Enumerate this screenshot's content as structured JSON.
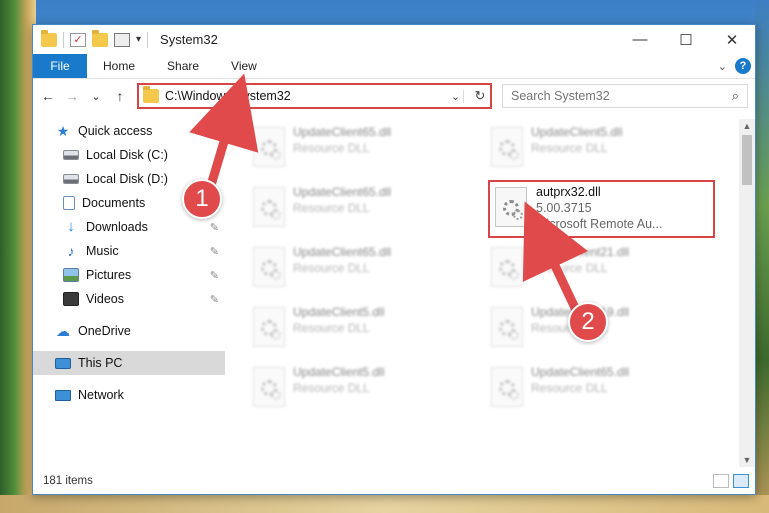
{
  "window": {
    "title": "System32",
    "controls": {
      "minimize": "—",
      "maximize": "☐",
      "close": "✕"
    }
  },
  "ribbon": {
    "file_tab": "File",
    "tabs": [
      "Home",
      "Share",
      "View"
    ],
    "expand_icon": "chevron-down-icon",
    "help": "?"
  },
  "nav": {
    "back": "←",
    "forward": "→",
    "recent": "⌄",
    "up": "↑"
  },
  "address": {
    "path": "C:\\Windows\\System32",
    "dropdown": "⌄",
    "refresh": "↻"
  },
  "search": {
    "placeholder": "Search System32",
    "icon": "⌕"
  },
  "sidebar": {
    "items": [
      {
        "label": "Quick access",
        "icon": "star-icon",
        "pinned": false
      },
      {
        "label": "Local Disk (C:)",
        "icon": "disk-icon",
        "pinned": false
      },
      {
        "label": "Local Disk (D:)",
        "icon": "disk-icon",
        "pinned": false
      },
      {
        "label": "Documents",
        "icon": "document-icon",
        "pinned": false
      },
      {
        "label": "Downloads",
        "icon": "download-icon",
        "pinned": true
      },
      {
        "label": "Music",
        "icon": "music-icon",
        "pinned": true
      },
      {
        "label": "Pictures",
        "icon": "pictures-icon",
        "pinned": true
      },
      {
        "label": "Videos",
        "icon": "video-icon",
        "pinned": true
      },
      {
        "label": "OneDrive",
        "icon": "cloud-icon"
      },
      {
        "label": "This PC",
        "icon": "computer-icon",
        "selected": true
      },
      {
        "label": "Network",
        "icon": "network-icon"
      }
    ],
    "pin_glyph": "📌"
  },
  "files": [
    {
      "name": "UpdateClient65.dll",
      "type": "Resource DLL"
    },
    {
      "name": "UpdateClient5.dll",
      "type": "Resource DLL"
    },
    {
      "name": "UpdateClient65.dll",
      "type": "Resource DLL"
    },
    {
      "name": "UpdateClient65.dll",
      "type": "Resource DLL"
    },
    {
      "name": "UpdateClient21.dll",
      "type": "Resource DLL"
    },
    {
      "name": "UpdateClient5.dll",
      "type": "Resource DLL"
    },
    {
      "name": "UpdateClient19.dll",
      "type": "Resource DLL"
    },
    {
      "name": "UpdateClient5.dll",
      "type": "Resource DLL"
    },
    {
      "name": "UpdateClient65.dll",
      "type": "Resource DLL"
    }
  ],
  "highlighted_file": {
    "name": "autprx32.dll",
    "version": "5.00.3715",
    "description": "Microsoft Remote Au..."
  },
  "status": {
    "item_count": "181 items"
  },
  "callouts": {
    "one": "1",
    "two": "2"
  },
  "colors": {
    "accent": "#1979ca",
    "highlight": "#d64545"
  }
}
